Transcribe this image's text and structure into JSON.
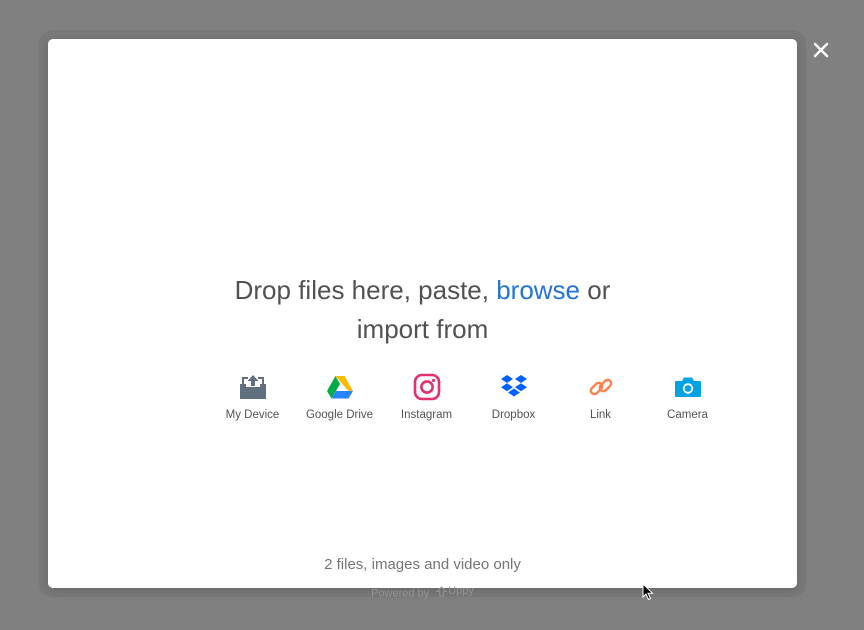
{
  "dashboard": {
    "title_line1_prefix": "Drop files here, paste, ",
    "browse_label": "browse",
    "title_line1_suffix": " or",
    "title_line2": "import from",
    "sources": [
      {
        "label": "My Device",
        "icon": "my-device-icon"
      },
      {
        "label": "Google Drive",
        "icon": "google-drive-icon"
      },
      {
        "label": "Instagram",
        "icon": "instagram-icon"
      },
      {
        "label": "Dropbox",
        "icon": "dropbox-icon"
      },
      {
        "label": "Link",
        "icon": "link-icon"
      },
      {
        "label": "Camera",
        "icon": "camera-icon"
      }
    ],
    "restrictions_note": "2 files, images and video only",
    "powered_by_text": "Powered by ",
    "brand_name": "Uppy"
  },
  "colors": {
    "overlay": "#808080",
    "accent": "#2275d7",
    "text": "#525252",
    "my_device": "#61707f",
    "instagram": "#e1306c",
    "dropbox": "#0061fe",
    "link": "#ff814f",
    "camera": "#03a2e1"
  }
}
